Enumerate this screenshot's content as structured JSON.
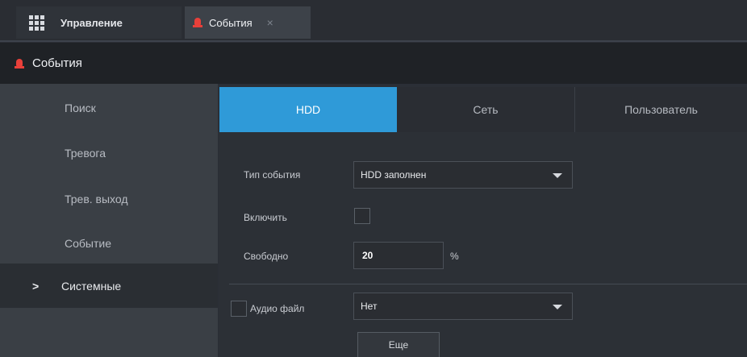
{
  "tabs": {
    "manage_label": "Управление",
    "events_label": "События",
    "close_glyph": "×"
  },
  "header": {
    "title": "События"
  },
  "sidebar": {
    "items": [
      {
        "label": "Поиск"
      },
      {
        "label": "Тревога"
      },
      {
        "label": "Трев. выход"
      },
      {
        "label": "Событие"
      },
      {
        "label": "Системные"
      }
    ],
    "active_arrow": ">"
  },
  "subtabs": [
    "HDD",
    "Сеть",
    "Пользователь"
  ],
  "form": {
    "event_type_label": "Тип события",
    "event_type_value": "HDD заполнен",
    "enable_label": "Включить",
    "free_label": "Свободно",
    "free_value": "20",
    "free_unit": "%",
    "audio_label": "Аудио файл",
    "audio_value": "Нет",
    "more_button": "Еще"
  },
  "colors": {
    "accent": "#2f9ad8",
    "alarm_icon": "#e8403a",
    "background": "#2b2f36"
  }
}
